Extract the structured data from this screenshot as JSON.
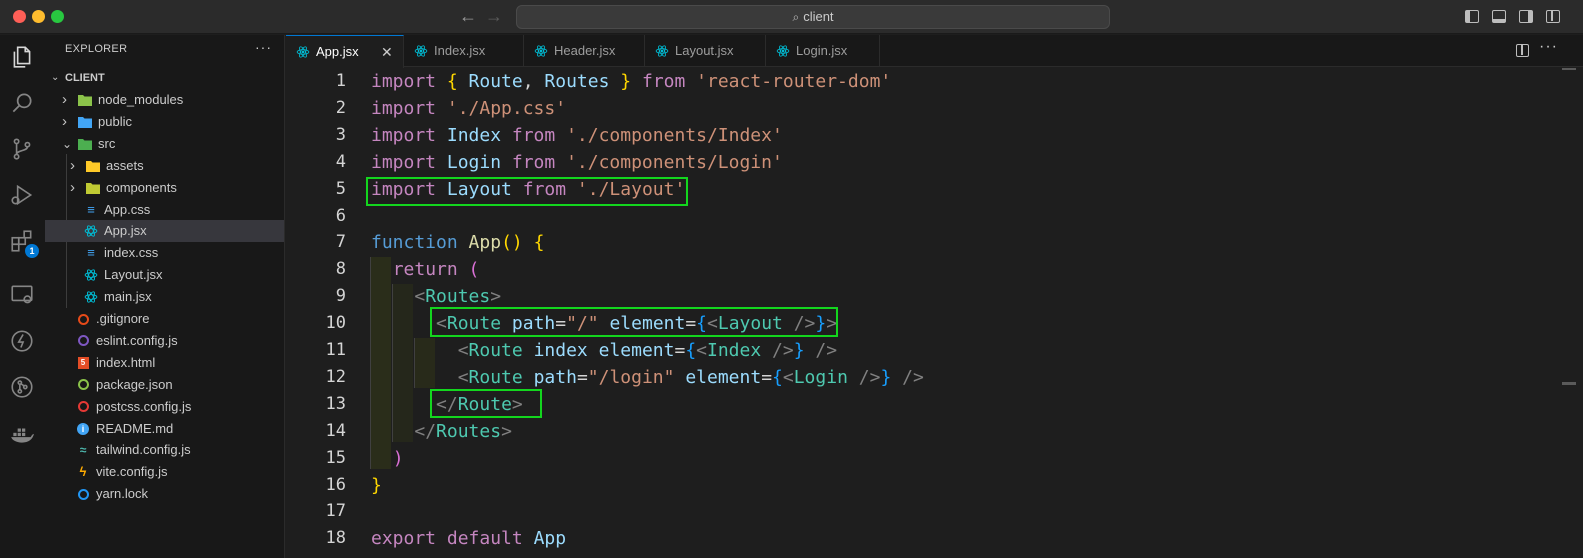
{
  "window": {
    "search_text": "client",
    "nav_back_icon": "arrow-left-icon",
    "nav_forward_icon": "arrow-right-icon"
  },
  "activity_bar": {
    "items": [
      {
        "icon": "files-icon",
        "name": "Explorer"
      },
      {
        "icon": "search-icon",
        "name": "Search"
      },
      {
        "icon": "source-control-icon",
        "name": "Source Control"
      },
      {
        "icon": "run-debug-icon",
        "name": "Run and Debug"
      },
      {
        "icon": "extensions-icon",
        "name": "Extensions",
        "badge": "1"
      },
      {
        "icon": "remote-explorer-icon",
        "name": "Remote Explorer"
      },
      {
        "icon": "lightning-icon",
        "name": "Thunder"
      },
      {
        "icon": "git-graph-icon",
        "name": "Git"
      },
      {
        "icon": "docker-icon",
        "name": "Docker"
      }
    ]
  },
  "sidebar": {
    "title": "EXPLORER",
    "more": "···",
    "root": "CLIENT",
    "tree": [
      {
        "label": "node_modules",
        "type": "folder",
        "icon": "node-folder-icon",
        "color": "#8bc34a"
      },
      {
        "label": "public",
        "type": "folder",
        "icon": "public-folder-icon",
        "color": "#42a5f5"
      },
      {
        "label": "src",
        "type": "folder-open",
        "icon": "src-folder-icon",
        "color": "#4caf50"
      },
      {
        "label": "assets",
        "type": "folder",
        "icon": "assets-folder-icon",
        "color": "#ffca28"
      },
      {
        "label": "components",
        "type": "folder",
        "icon": "components-folder-icon",
        "color": "#c0ca33"
      },
      {
        "label": "App.css",
        "type": "file",
        "icon": "css-file-icon",
        "color": "#42a5f5"
      },
      {
        "label": "App.jsx",
        "type": "file",
        "icon": "react-file-icon",
        "color": "#00bcd4",
        "selected": true
      },
      {
        "label": "index.css",
        "type": "file",
        "icon": "css-file-icon",
        "color": "#42a5f5"
      },
      {
        "label": "Layout.jsx",
        "type": "file",
        "icon": "react-file-icon",
        "color": "#00bcd4"
      },
      {
        "label": "main.jsx",
        "type": "file",
        "icon": "react-file-icon",
        "color": "#00bcd4"
      },
      {
        "label": ".gitignore",
        "type": "file",
        "icon": "git-file-icon",
        "color": "#e64a19"
      },
      {
        "label": "eslint.config.js",
        "type": "file",
        "icon": "eslint-file-icon",
        "color": "#7e57c2"
      },
      {
        "label": "index.html",
        "type": "file",
        "icon": "html-file-icon",
        "color": "#e44d26"
      },
      {
        "label": "package.json",
        "type": "file",
        "icon": "nodejs-file-icon",
        "color": "#8bc34a"
      },
      {
        "label": "postcss.config.js",
        "type": "file",
        "icon": "postcss-file-icon",
        "color": "#e53935"
      },
      {
        "label": "README.md",
        "type": "file",
        "icon": "info-file-icon",
        "color": "#42a5f5"
      },
      {
        "label": "tailwind.config.js",
        "type": "file",
        "icon": "tailwind-file-icon",
        "color": "#4db6ac"
      },
      {
        "label": "vite.config.js",
        "type": "file",
        "icon": "vite-file-icon",
        "color": "#ffab00"
      },
      {
        "label": "yarn.lock",
        "type": "file",
        "icon": "yarn-file-icon",
        "color": "#2196f3"
      }
    ]
  },
  "tabs": [
    {
      "label": "App.jsx",
      "active": true,
      "close": "✕"
    },
    {
      "label": "Index.jsx",
      "active": false
    },
    {
      "label": "Header.jsx",
      "active": false
    },
    {
      "label": "Layout.jsx",
      "active": false
    },
    {
      "label": "Login.jsx",
      "active": false
    }
  ],
  "editor": {
    "lines": [
      {
        "n": "1",
        "tokens": [
          [
            "kw",
            "import "
          ],
          [
            "br1",
            "{ "
          ],
          [
            "id",
            "Route"
          ],
          [
            "plain",
            ", "
          ],
          [
            "id",
            "Routes"
          ],
          [
            "br1",
            " }"
          ],
          [
            "kw",
            " from "
          ],
          [
            "str",
            "'react-router-dom'"
          ]
        ]
      },
      {
        "n": "2",
        "tokens": [
          [
            "kw",
            "import "
          ],
          [
            "str",
            "'./App.css'"
          ]
        ]
      },
      {
        "n": "3",
        "tokens": [
          [
            "kw",
            "import "
          ],
          [
            "id",
            "Index"
          ],
          [
            "kw",
            " from "
          ],
          [
            "str",
            "'./components/Index'"
          ]
        ]
      },
      {
        "n": "4",
        "tokens": [
          [
            "kw",
            "import "
          ],
          [
            "id",
            "Login"
          ],
          [
            "kw",
            " from "
          ],
          [
            "str",
            "'./components/Login'"
          ]
        ]
      },
      {
        "n": "5",
        "tokens": [
          [
            "kw",
            "import "
          ],
          [
            "id",
            "Layout"
          ],
          [
            "kw",
            " from "
          ],
          [
            "str",
            "'./Layout'"
          ]
        ]
      },
      {
        "n": "6",
        "tokens": []
      },
      {
        "n": "7",
        "tokens": [
          [
            "kw2",
            "function "
          ],
          [
            "fn",
            "App"
          ],
          [
            "br1",
            "() {"
          ]
        ]
      },
      {
        "n": "8",
        "tokens": [
          [
            "plain",
            "  "
          ],
          [
            "kw",
            "return "
          ],
          [
            "br2",
            "("
          ]
        ]
      },
      {
        "n": "9",
        "tokens": [
          [
            "plain",
            "    "
          ],
          [
            "tagp",
            "<"
          ],
          [
            "tag",
            "Routes"
          ],
          [
            "tagp",
            ">"
          ]
        ]
      },
      {
        "n": "10",
        "tokens": [
          [
            "plain",
            "      "
          ],
          [
            "tagp",
            "<"
          ],
          [
            "tag",
            "Route "
          ],
          [
            "attr",
            "path"
          ],
          [
            "plain",
            "="
          ],
          [
            "str",
            "\"/\""
          ],
          [
            "plain",
            " "
          ],
          [
            "attr",
            "element"
          ],
          [
            "plain",
            "="
          ],
          [
            "br3",
            "{"
          ],
          [
            "tagp",
            "<"
          ],
          [
            "tag",
            "Layout "
          ],
          [
            "tagp",
            "/>"
          ],
          [
            "br3",
            "}"
          ],
          [
            "tagp",
            ">"
          ]
        ]
      },
      {
        "n": "11",
        "tokens": [
          [
            "plain",
            "        "
          ],
          [
            "tagp",
            "<"
          ],
          [
            "tag",
            "Route "
          ],
          [
            "attr",
            "index "
          ],
          [
            "attr",
            "element"
          ],
          [
            "plain",
            "="
          ],
          [
            "br3",
            "{"
          ],
          [
            "tagp",
            "<"
          ],
          [
            "tag",
            "Index "
          ],
          [
            "tagp",
            "/>"
          ],
          [
            "br3",
            "}"
          ],
          [
            "plain",
            " "
          ],
          [
            "tagp",
            "/>"
          ]
        ]
      },
      {
        "n": "12",
        "tokens": [
          [
            "plain",
            "        "
          ],
          [
            "tagp",
            "<"
          ],
          [
            "tag",
            "Route "
          ],
          [
            "attr",
            "path"
          ],
          [
            "plain",
            "="
          ],
          [
            "str",
            "\"/login\""
          ],
          [
            "plain",
            " "
          ],
          [
            "attr",
            "element"
          ],
          [
            "plain",
            "="
          ],
          [
            "br3",
            "{"
          ],
          [
            "tagp",
            "<"
          ],
          [
            "tag",
            "Login "
          ],
          [
            "tagp",
            "/>"
          ],
          [
            "br3",
            "}"
          ],
          [
            "plain",
            " "
          ],
          [
            "tagp",
            "/>"
          ]
        ]
      },
      {
        "n": "13",
        "tokens": [
          [
            "plain",
            "      "
          ],
          [
            "tagp",
            "</"
          ],
          [
            "tag",
            "Route"
          ],
          [
            "tagp",
            ">"
          ]
        ]
      },
      {
        "n": "14",
        "tokens": [
          [
            "plain",
            "    "
          ],
          [
            "tagp",
            "</"
          ],
          [
            "tag",
            "Routes"
          ],
          [
            "tagp",
            ">"
          ]
        ]
      },
      {
        "n": "15",
        "tokens": [
          [
            "plain",
            "  "
          ],
          [
            "br2",
            ")"
          ]
        ]
      },
      {
        "n": "16",
        "tokens": [
          [
            "br1",
            "}"
          ]
        ]
      },
      {
        "n": "17",
        "tokens": []
      },
      {
        "n": "18",
        "tokens": [
          [
            "kw",
            "export "
          ],
          [
            "kw",
            "default "
          ],
          [
            "id",
            "App"
          ]
        ]
      }
    ],
    "highlight_color": "#13d61e"
  }
}
